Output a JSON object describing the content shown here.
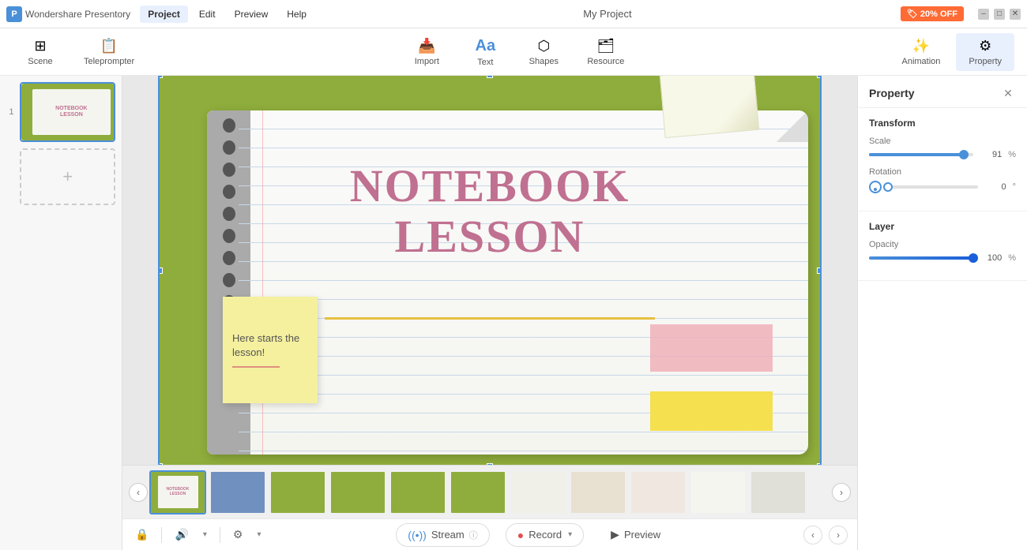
{
  "titlebar": {
    "app_name": "Wondershare Presentory",
    "menus": [
      "Project",
      "Edit",
      "Preview",
      "Help"
    ],
    "active_menu": "Project",
    "project_title": "My Project",
    "promo": "🏷 20% OFF"
  },
  "toolbar": {
    "items": [
      {
        "id": "scene",
        "icon": "⊞",
        "label": "Scene"
      },
      {
        "id": "teleprompter",
        "icon": "📝",
        "label": "Teleprompter"
      },
      {
        "id": "import",
        "icon": "📥",
        "label": "Import"
      },
      {
        "id": "text",
        "icon": "T",
        "label": "Text"
      },
      {
        "id": "shapes",
        "icon": "⬡",
        "label": "Shapes"
      },
      {
        "id": "resource",
        "icon": "🗂",
        "label": "Resource"
      }
    ],
    "right_items": [
      {
        "id": "animation",
        "icon": "✨",
        "label": "Animation"
      },
      {
        "id": "property",
        "icon": "⚙",
        "label": "Property"
      }
    ]
  },
  "canvas": {
    "title_line1": "NOTEBOOK",
    "title_line2": "LESSON",
    "sticky_text": "Here starts the lesson!"
  },
  "filmstrip": {
    "thumbs": [
      {
        "id": 1,
        "active": true,
        "color": "#8fad3c"
      },
      {
        "id": 2,
        "active": false,
        "color": "#5580b0"
      },
      {
        "id": 3,
        "active": false,
        "color": "#8fad3c"
      },
      {
        "id": 4,
        "active": false,
        "color": "#8fad3c"
      },
      {
        "id": 5,
        "active": false,
        "color": "#8fad3c"
      },
      {
        "id": 6,
        "active": false,
        "color": "#8fad3c"
      },
      {
        "id": 7,
        "active": false,
        "color": "#f0f0e8"
      },
      {
        "id": 8,
        "active": false,
        "color": "#e8e0d0"
      },
      {
        "id": 9,
        "active": false,
        "color": "#f0e8e0"
      },
      {
        "id": 10,
        "active": false,
        "color": "#f5f5f0"
      },
      {
        "id": 11,
        "active": false,
        "color": "#e0e0d8"
      }
    ]
  },
  "bottombar": {
    "stream_label": "Stream",
    "record_label": "Record",
    "preview_label": "Preview"
  },
  "property_panel": {
    "title": "Property",
    "close_icon": "✕",
    "transform_section": "Transform",
    "scale_label": "Scale",
    "scale_value": "91",
    "scale_unit": "%",
    "scale_percent": 91,
    "rotation_label": "Rotation",
    "rotation_value": "0",
    "rotation_angle": 0,
    "layer_section": "Layer",
    "opacity_label": "Opacity",
    "opacity_value": "100",
    "opacity_unit": "%",
    "opacity_percent": 100
  }
}
